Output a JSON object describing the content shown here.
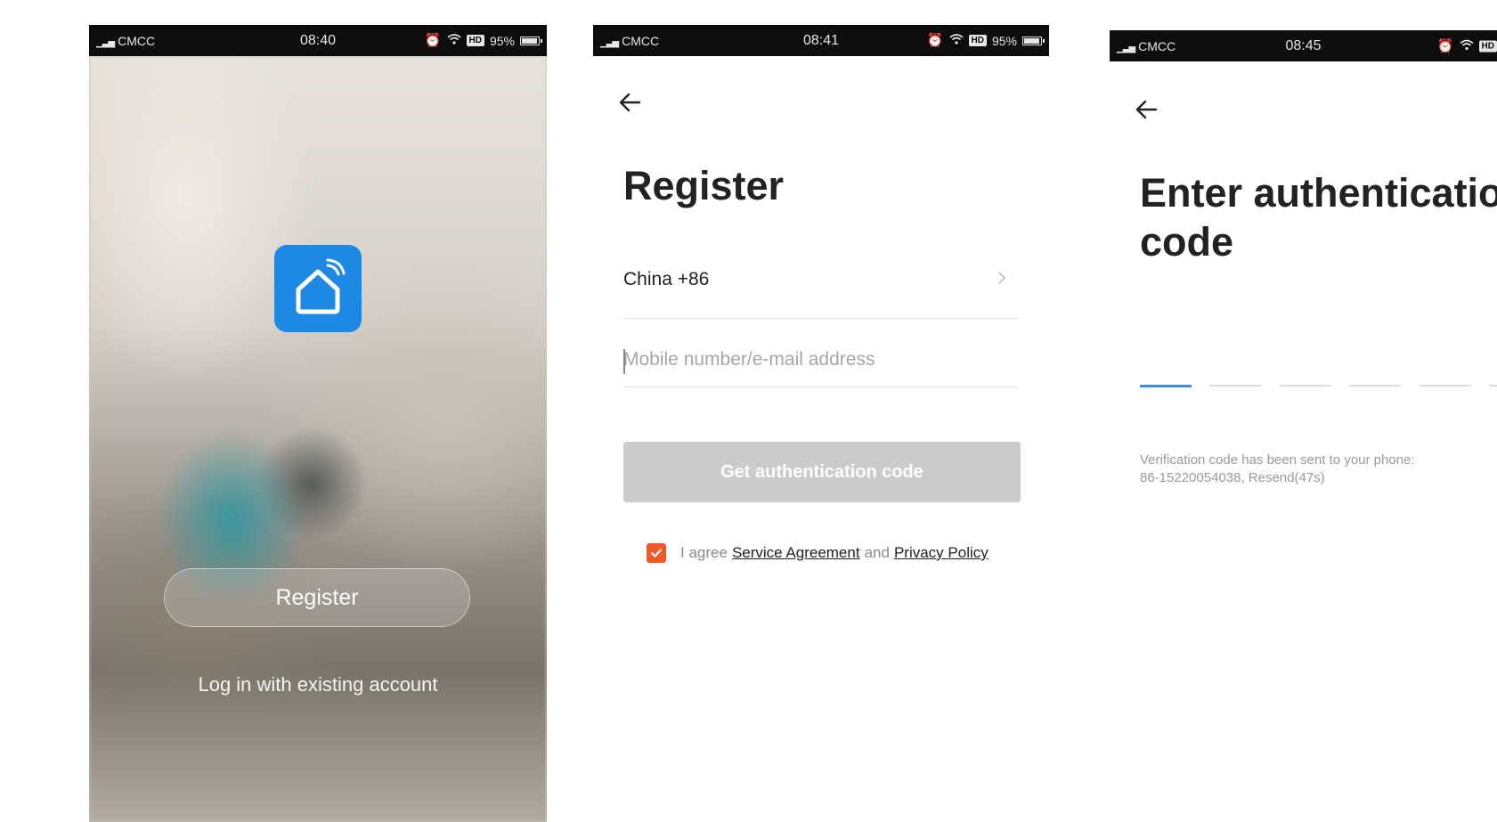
{
  "screen1": {
    "status": {
      "carrier": "CMCC",
      "time": "08:40",
      "hd": "HD",
      "battery": "95%"
    },
    "register_label": "Register",
    "login_label": "Log in with existing account"
  },
  "screen2": {
    "status": {
      "carrier": "CMCC",
      "time": "08:41",
      "hd": "HD",
      "battery": "95%"
    },
    "title": "Register",
    "country": "China +86",
    "phone_placeholder": "Mobile number/e-mail address",
    "get_code_label": "Get authentication code",
    "agree_prefix": "I agree",
    "service_agreement": "Service Agreement",
    "and_word": "and",
    "privacy_policy": "Privacy Policy",
    "agree_checked": true
  },
  "screen3": {
    "status": {
      "carrier": "CMCC",
      "time": "08:45",
      "hd": "HD"
    },
    "title_line1": "Enter authentication",
    "title_line2": "code",
    "verify_line1": "Verification code has been sent to your phone:",
    "verify_line2": "86-15220054038, Resend(47s)"
  },
  "colors": {
    "accent_blue": "#1e88e5",
    "checkbox_orange": "#f05a28",
    "disabled_button": "#cbcbcb",
    "active_slot": "#3a8ee6"
  }
}
